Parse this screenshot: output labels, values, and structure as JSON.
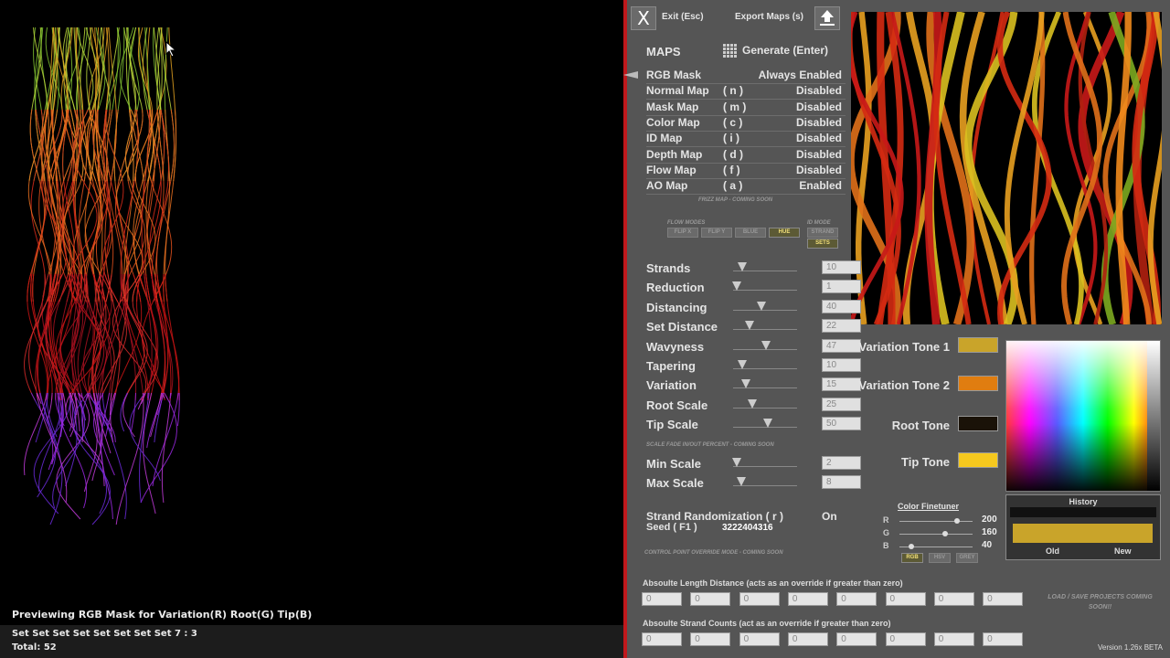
{
  "preview": {
    "status": "Previewing RGB Mask for Variation(R) Root(G) Tip(B)",
    "set_line": "Set Set Set Set Set Set Set Set 7 : 3",
    "total_label": "Total:",
    "total_value": "52"
  },
  "toolbar": {
    "exit_icon": "X",
    "exit_label": "Exit (Esc)",
    "export_label": "Export Maps (s)"
  },
  "maps": {
    "header": "MAPS",
    "generate_label": "Generate (Enter)",
    "rows": [
      {
        "name": "RGB Mask",
        "key": "",
        "state": "Always Enabled"
      },
      {
        "name": "Normal Map",
        "key": "( n )",
        "state": "Disabled"
      },
      {
        "name": "Mask Map",
        "key": "( m )",
        "state": "Disabled"
      },
      {
        "name": "Color Map",
        "key": "( c )",
        "state": "Disabled"
      },
      {
        "name": "ID Map",
        "key": "( i )",
        "state": "Disabled"
      },
      {
        "name": "Depth Map",
        "key": "( d )",
        "state": "Disabled"
      },
      {
        "name": "Flow Map",
        "key": "( f )",
        "state": "Disabled"
      },
      {
        "name": "AO Map",
        "key": "( a )",
        "state": "Enabled"
      }
    ],
    "frizz_note": "FRIZZ MAP - COMING SOON"
  },
  "flow_modes": {
    "label": "FLOW MODES",
    "buttons": [
      "FLIP X",
      "FLIP Y",
      "BLUE",
      "HUE"
    ],
    "active": "HUE"
  },
  "id_mode": {
    "label": "ID MODE",
    "buttons": [
      "STRAND",
      "SETS"
    ],
    "active": "SETS"
  },
  "sliders": [
    {
      "label": "Strands",
      "value": "10",
      "level": 0.1
    },
    {
      "label": "Reduction",
      "value": "1",
      "level": 0.01
    },
    {
      "label": "Distancing",
      "value": "40",
      "level": 0.4
    },
    {
      "label": "Set Distance",
      "value": "22",
      "level": 0.22
    },
    {
      "label": "Wavyness",
      "value": "47",
      "level": 0.47
    },
    {
      "label": "Tapering",
      "value": "10",
      "level": 0.1
    },
    {
      "label": "Variation",
      "value": "15",
      "level": 0.15
    },
    {
      "label": "Root Scale",
      "value": "25",
      "level": 0.25
    },
    {
      "label": "Tip Scale",
      "value": "50",
      "level": 0.5
    }
  ],
  "scale_fade_note": "SCALE FADE IN/OUT PERCENT - COMING SOON",
  "scale_sliders": [
    {
      "label": "Min Scale",
      "value": "2",
      "level": 0.02
    },
    {
      "label": "Max Scale",
      "value": "8",
      "level": 0.08
    }
  ],
  "randomization": {
    "label": "Strand Randomization ( r )",
    "state": "On",
    "seed_label": "Seed ( F1 )",
    "seed_value": "3222404316"
  },
  "control_point_note": "CONTROL POINT OVERRIDE MODE - COMING SOON",
  "tones": [
    {
      "label": "Variation Tone 1",
      "color": "#c9a42a"
    },
    {
      "label": "Variation Tone 2",
      "color": "#e07d10"
    },
    {
      "label": "Root Tone",
      "color": "#1a1208"
    },
    {
      "label": "Tip Tone",
      "color": "#f5c81e"
    }
  ],
  "finetuner": {
    "title": "Color Finetuner",
    "channels": [
      {
        "label": "R",
        "value": "200",
        "level": 0.784
      },
      {
        "label": "G",
        "value": "160",
        "level": 0.627
      },
      {
        "label": "B",
        "value": "40",
        "level": 0.157
      }
    ],
    "modes": [
      "RGB",
      "HSV",
      "GREY"
    ],
    "active_mode": "RGB"
  },
  "history": {
    "title": "History",
    "old_label": "Old",
    "new_label": "New",
    "old_color": "#111111",
    "new_color": "#c9a42a"
  },
  "abs_length": {
    "label": "Absoulte Length Distance (acts as an override if greater than zero)",
    "values": [
      "0",
      "0",
      "0",
      "0",
      "0",
      "0",
      "0",
      "0"
    ]
  },
  "abs_counts": {
    "label": "Absoulte Strand Counts (act as an override if greater than zero)",
    "values": [
      "0",
      "0",
      "0",
      "0",
      "0",
      "0",
      "0",
      "0"
    ]
  },
  "load_save_note": "LOAD / SAVE PROJECTS COMING SOON!!",
  "version": "Version 1.26x BETA"
}
